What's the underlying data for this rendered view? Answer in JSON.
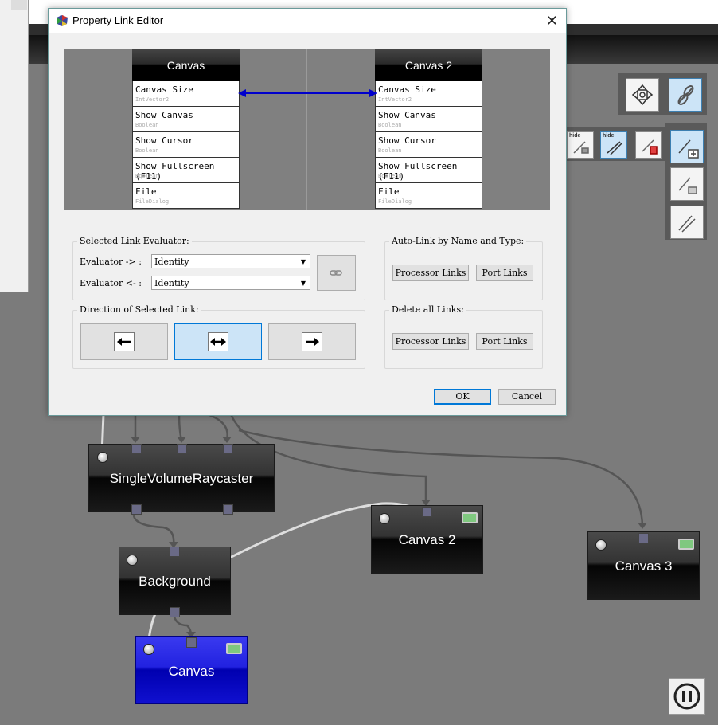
{
  "dialog": {
    "title": "Property Link Editor",
    "close_glyph": "✕",
    "left_node": {
      "title": "Canvas",
      "properties": [
        {
          "name": "Canvas Size",
          "type": "IntVector2"
        },
        {
          "name": "Show Canvas",
          "type": "Boolean"
        },
        {
          "name": "Show Cursor",
          "type": "Boolean"
        },
        {
          "name": "Show Fullscreen (F11)",
          "type": "Boolean"
        },
        {
          "name": "File",
          "type": "FileDialog"
        }
      ]
    },
    "right_node": {
      "title": "Canvas 2",
      "properties": [
        {
          "name": "Canvas Size",
          "type": "IntVector2"
        },
        {
          "name": "Show Canvas",
          "type": "Boolean"
        },
        {
          "name": "Show Cursor",
          "type": "Boolean"
        },
        {
          "name": "Show Fullscreen (F11)",
          "type": "Boolean"
        },
        {
          "name": "File",
          "type": "FileDialog"
        }
      ]
    },
    "link_color": "#0000cc",
    "evaluator_group": {
      "label": "Selected Link Evaluator:",
      "forward_label": "Evaluator -> :",
      "forward_value": "Identity",
      "backward_label": "Evaluator <- :",
      "backward_value": "Identity"
    },
    "autolink_group": {
      "label": "Auto-Link by Name and Type:",
      "processor_links": "Processor Links",
      "port_links": "Port Links"
    },
    "direction_group": {
      "label": "Direction of Selected Link:",
      "selected": "bidirectional"
    },
    "delete_group": {
      "label": "Delete all Links:",
      "processor_links": "Processor Links",
      "port_links": "Port Links"
    },
    "ok_label": "OK",
    "cancel_label": "Cancel"
  },
  "network": {
    "nodes": {
      "raycaster": "SingleVolumeRaycaster",
      "background": "Background",
      "canvas": "Canvas",
      "canvas2": "Canvas 2",
      "canvas3": "Canvas 3"
    }
  },
  "toolbar": {
    "hide_label": "hide"
  },
  "colors": {
    "accent": "#0078d7",
    "selected_node": "#2222e0",
    "workspace": "#7b7b7b"
  }
}
